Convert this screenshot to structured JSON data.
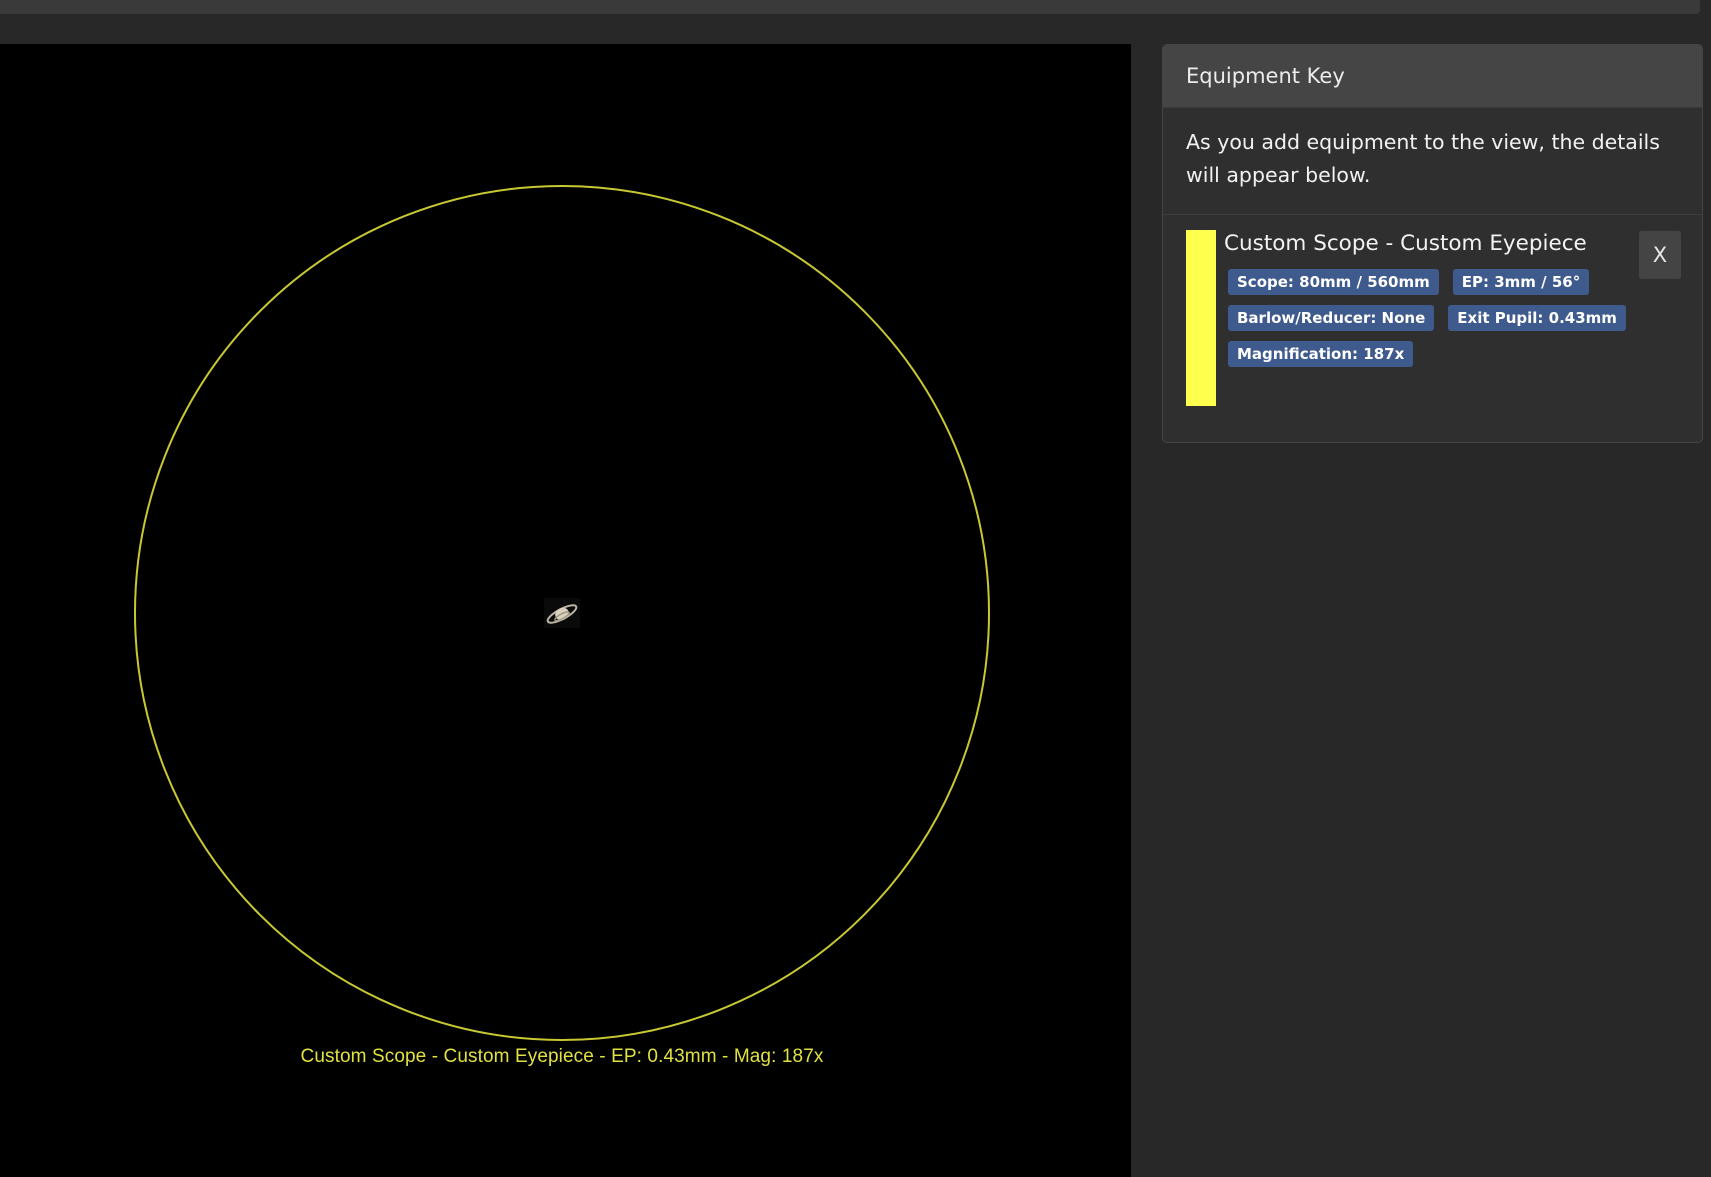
{
  "viewer": {
    "fov_label": "Custom Scope - Custom Eyepiece - EP: 0.43mm - Mag: 187x",
    "fov_ring_color": "#c8c832",
    "object_icon": "saturn-icon"
  },
  "equipment_key": {
    "title": "Equipment Key",
    "intro": "As you add equipment to the view, the details will appear below.",
    "items": [
      {
        "color": "#ffff4d",
        "name": "Custom Scope - Custom Eyepiece",
        "remove_label": "X",
        "badges": {
          "scope": "Scope: 80mm / 560mm",
          "ep": "EP: 3mm / 56°",
          "barlow": "Barlow/Reducer: None",
          "exit_pupil": "Exit Pupil: 0.43mm",
          "magnification": "Magnification: 187x"
        }
      }
    ]
  }
}
